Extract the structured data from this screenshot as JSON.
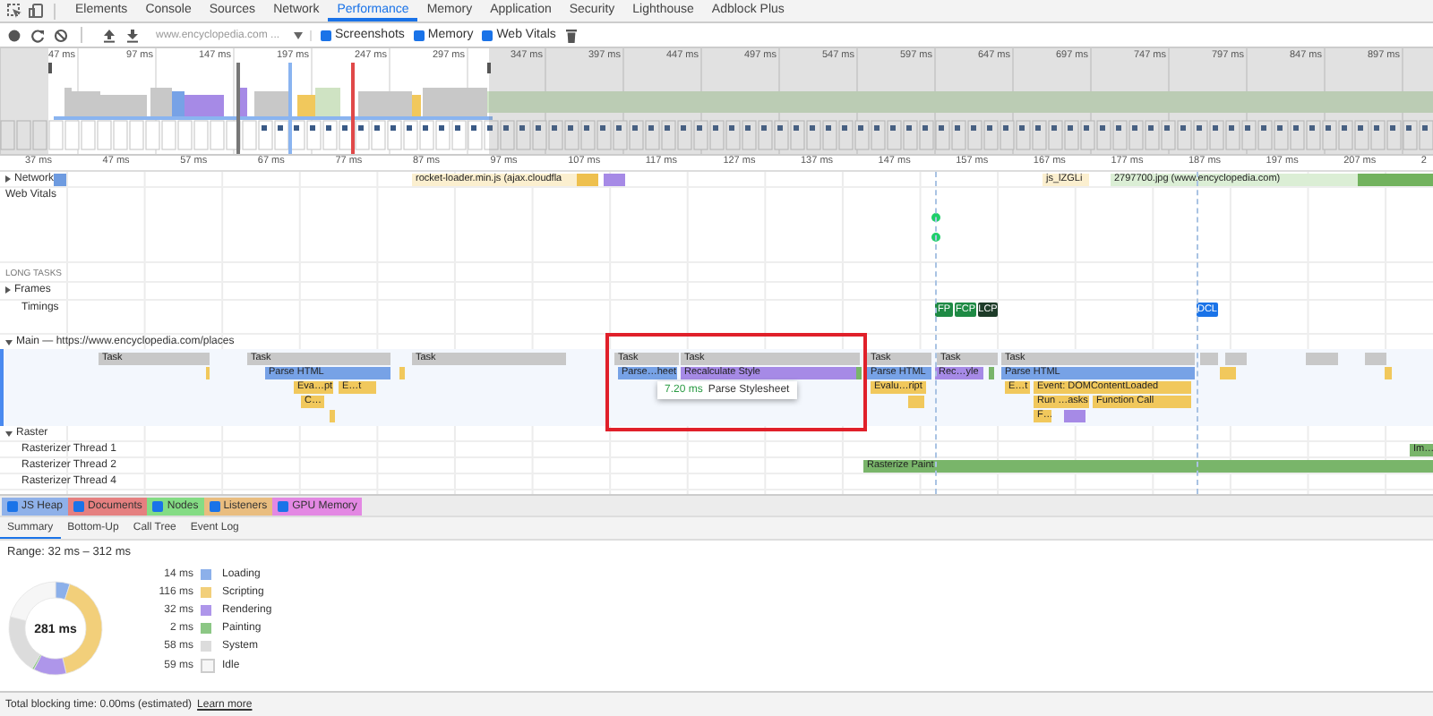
{
  "tabs": [
    {
      "label": "Elements",
      "selected": false
    },
    {
      "label": "Console",
      "selected": false
    },
    {
      "label": "Sources",
      "selected": false
    },
    {
      "label": "Network",
      "selected": false
    },
    {
      "label": "Performance",
      "selected": true
    },
    {
      "label": "Memory",
      "selected": false
    },
    {
      "label": "Application",
      "selected": false
    },
    {
      "label": "Security",
      "selected": false
    },
    {
      "label": "Lighthouse",
      "selected": false
    },
    {
      "label": "Adblock Plus",
      "selected": false
    }
  ],
  "toolbar": {
    "url": "www.encyclopedia.com ...",
    "checkboxes": [
      {
        "label": "Screenshots",
        "checked": true
      },
      {
        "label": "Memory",
        "checked": true
      },
      {
        "label": "Web Vitals",
        "checked": true
      }
    ]
  },
  "overview": {
    "ticks": [
      "47 ms",
      "97 ms",
      "147 ms",
      "197 ms",
      "247 ms",
      "297 ms",
      "347 ms",
      "397 ms",
      "447 ms",
      "497 ms",
      "547 ms",
      "597 ms",
      "647 ms",
      "697 ms",
      "747 ms",
      "797 ms",
      "847 ms",
      "897 ms"
    ]
  },
  "ruler": {
    "ticks": [
      "37 ms",
      "47 ms",
      "57 ms",
      "67 ms",
      "77 ms",
      "87 ms",
      "97 ms",
      "107 ms",
      "117 ms",
      "127 ms",
      "137 ms",
      "147 ms",
      "157 ms",
      "167 ms",
      "177 ms",
      "187 ms",
      "197 ms",
      "207 ms",
      "2"
    ]
  },
  "network": {
    "label": "Network",
    "expanded": false,
    "requests": [
      {
        "kind": "document"
      },
      {
        "label": "rocket-loader.min.js (ajax.cloudfla",
        "kind": "script"
      },
      {
        "kind": "stylesheet"
      },
      {
        "label": "js_lZGLi",
        "kind": "script"
      },
      {
        "label": "2797700.jpg (www.encyclopedia.com)",
        "kind": "image"
      }
    ]
  },
  "web_vitals": {
    "label": "Web Vitals",
    "markers": [
      {
        "color": "#1fcf6a"
      },
      {
        "color": "#1fcf6a"
      }
    ]
  },
  "long_tasks": {
    "label": "LONG TASKS"
  },
  "frames": {
    "label": "Frames",
    "expanded": false
  },
  "timings": {
    "label": "Timings",
    "markers": [
      {
        "label": "FP",
        "color": "#1e8a44"
      },
      {
        "label": "FCP",
        "color": "#1e8a44"
      },
      {
        "label": "LCP",
        "color": "#1d3b28"
      },
      {
        "label": "DCL",
        "color": "#1a73e8"
      }
    ]
  },
  "main": {
    "label": "Main — https://www.encyclopedia.com/places",
    "expanded": true,
    "events": [
      {
        "label": "Task",
        "kind": "task"
      },
      {
        "label": "Task",
        "kind": "task"
      },
      {
        "label": "Task",
        "kind": "task"
      },
      {
        "label": "Task",
        "kind": "task"
      },
      {
        "label": "Task",
        "kind": "task"
      },
      {
        "label": "Task",
        "kind": "task"
      },
      {
        "label": "Task",
        "kind": "task"
      },
      {
        "label": "Task",
        "kind": "task"
      },
      {
        "kind": "task"
      },
      {
        "kind": "task"
      },
      {
        "kind": "task"
      },
      {
        "kind": "task"
      },
      {
        "label": "Parse HTML",
        "kind": "loading"
      },
      {
        "label": "Parse…heet",
        "kind": "loading"
      },
      {
        "label": "Recalculate Style",
        "kind": "rendering"
      },
      {
        "label": "Parse HTML",
        "kind": "loading"
      },
      {
        "label": "Rec…yle",
        "kind": "rendering"
      },
      {
        "label": "Parse HTML",
        "kind": "loading"
      },
      {
        "kind": "painting"
      },
      {
        "kind": "painting"
      },
      {
        "kind": "scripting"
      },
      {
        "kind": "scripting"
      },
      {
        "label": "Eva…pt",
        "kind": "scripting"
      },
      {
        "label": "E…t",
        "kind": "scripting"
      },
      {
        "label": "Evalu…ript",
        "kind": "scripting"
      },
      {
        "label": "E…t",
        "kind": "scripting"
      },
      {
        "label": "Event: DOMContentLoaded",
        "kind": "scripting"
      },
      {
        "label": "C…",
        "kind": "scripting"
      },
      {
        "label": "Run …asks",
        "kind": "scripting"
      },
      {
        "label": "Function Call",
        "kind": "scripting"
      },
      {
        "kind": "scripting"
      },
      {
        "label": "F…",
        "kind": "scripting"
      },
      {
        "kind": "rendering"
      },
      {
        "kind": "scripting"
      },
      {
        "kind": "scripting"
      },
      {
        "kind": "scripting"
      }
    ]
  },
  "tooltip": {
    "duration": "7.20 ms",
    "label": "Parse Stylesheet"
  },
  "raster": {
    "label": "Raster",
    "expanded": true,
    "threads": [
      {
        "label": "Rasterizer Thread 1",
        "events": [
          {
            "label": "Im…",
            "kind": "painting"
          }
        ]
      },
      {
        "label": "Rasterizer Thread 2",
        "events": [
          {
            "label": "Rasterize Paint",
            "kind": "painting"
          }
        ]
      },
      {
        "label": "Rasterizer Thread 4"
      }
    ]
  },
  "counters": [
    {
      "label": "JS Heap",
      "checked": true,
      "color": "#8fb1e9"
    },
    {
      "label": "Documents",
      "checked": true,
      "color": "#e58080"
    },
    {
      "label": "Nodes",
      "checked": true,
      "color": "#84dc84"
    },
    {
      "label": "Listeners",
      "checked": true,
      "color": "#e9bd7f"
    },
    {
      "label": "GPU Memory",
      "checked": true,
      "color": "#e388e3"
    }
  ],
  "details_tabs": [
    {
      "label": "Summary",
      "selected": true
    },
    {
      "label": "Bottom-Up",
      "selected": false
    },
    {
      "label": "Call Tree",
      "selected": false
    },
    {
      "label": "Event Log",
      "selected": false
    }
  ],
  "summary": {
    "range": "Range: 32 ms – 312 ms",
    "total": "281 ms",
    "items": [
      {
        "value": "14 ms",
        "color": "#8cb0ea"
      },
      {
        "value": "116 ms",
        "color": "#f2cf7a"
      },
      {
        "value": "32 ms",
        "color": "#ae96ea"
      },
      {
        "value": "2 ms",
        "color": "#8cc785"
      },
      {
        "value": "58 ms",
        "color": "#dcdcdc"
      },
      {
        "value": "59 ms",
        "color": "#f6f6f6"
      }
    ],
    "chart_data": {
      "type": "donut",
      "categories": [
        "Loading",
        "Scripting",
        "Rendering",
        "Painting",
        "System",
        "Idle"
      ],
      "values": [
        5.0,
        41.3,
        11.4,
        0.7,
        20.6,
        21.0
      ]
    }
  },
  "status_bar": {
    "text": "Total blocking time: 0.00ms (estimated)",
    "link": "Learn more"
  }
}
